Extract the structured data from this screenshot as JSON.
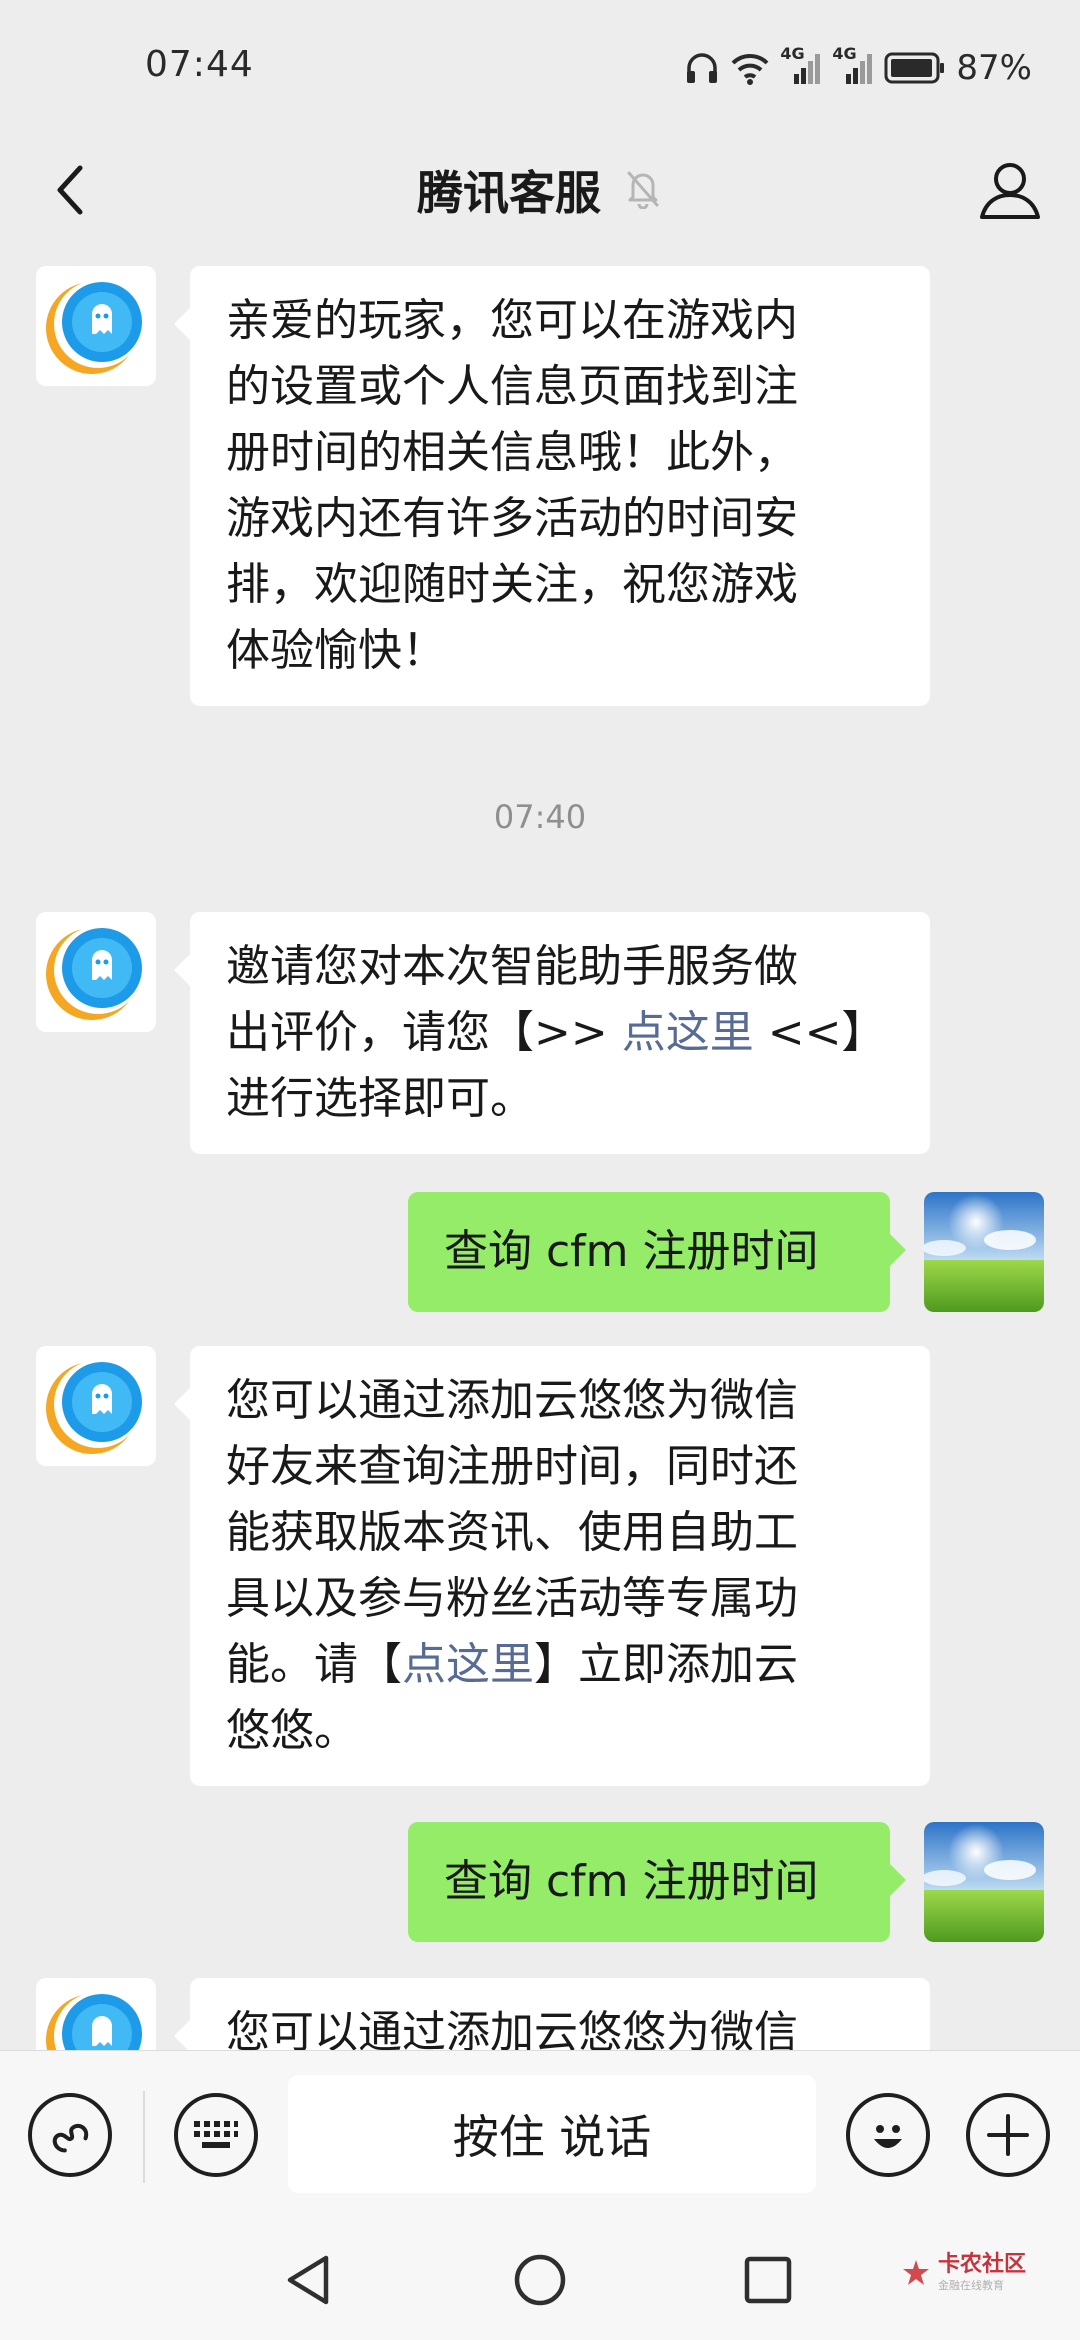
{
  "status_bar": {
    "time": "07:44",
    "network_1": "4G",
    "network_2": "4G",
    "battery": "87%"
  },
  "header": {
    "title": "腾讯客服"
  },
  "messages": [
    {
      "sender": "tencent-service",
      "lines": [
        "亲爱的玩家，您可以在游戏内",
        "的设置或个人信息页面找到注",
        "册时间的相关信息哦！此外，",
        "游戏内还有许多活动的时间安",
        "排，欢迎随时关注，祝您游戏",
        "体验愉快！"
      ]
    },
    {
      "type": "timestamp",
      "text": "07:40"
    },
    {
      "sender": "tencent-service",
      "lines": [
        "邀请您对本次智能助手服务做"
      ],
      "line2_prefix": "出评价，请您【>> ",
      "line2_link": "点这里",
      "line2_suffix": " <<】",
      "line3": "进行选择即可。"
    },
    {
      "sender": "me",
      "text": "查询 cfm 注册时间"
    },
    {
      "sender": "tencent-service",
      "lines": [
        "您可以通过添加云悠悠为微信",
        "好友来查询注册时间，同时还",
        "能获取版本资讯、使用自助工",
        "具以及参与粉丝活动等专属功"
      ],
      "line5_prefix": "能。请【",
      "line5_link": "点这里",
      "line5_suffix": "】立即添加云",
      "line6": "悠悠。"
    },
    {
      "sender": "me",
      "text": "查询 cfm 注册时间"
    },
    {
      "sender": "tencent-service",
      "text": "您可以通过添加云悠悠为微信"
    }
  ],
  "input_bar": {
    "hold_to_talk": "按住 说话"
  },
  "watermark": {
    "main": "卡农社区",
    "sub": "金融在线教育"
  },
  "colors": {
    "background": "#ededed",
    "bubble_white": "#ffffff",
    "bubble_green": "#95ec69",
    "link": "#576b95"
  }
}
